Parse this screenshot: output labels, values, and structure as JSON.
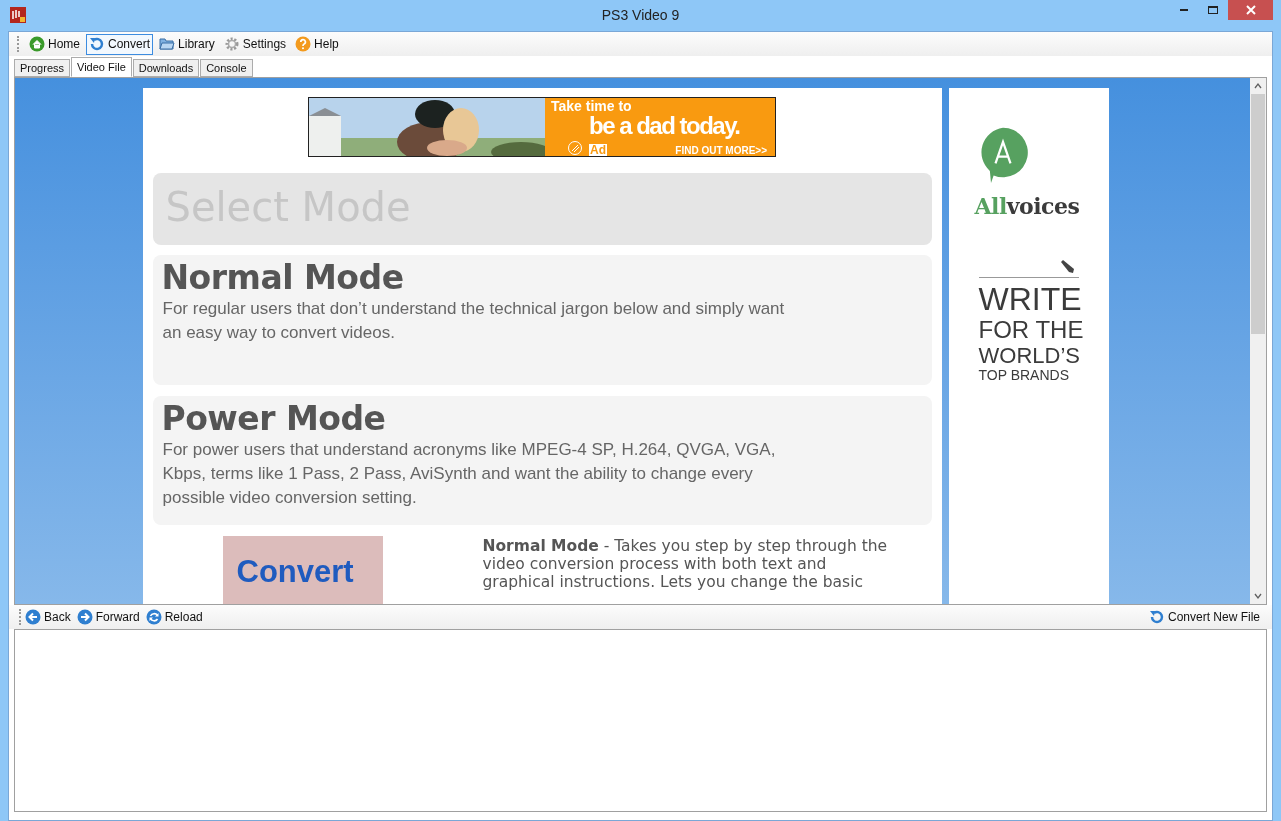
{
  "window": {
    "title": "PS3 Video 9"
  },
  "toolbar": [
    {
      "label": "Home",
      "selected": false
    },
    {
      "label": "Convert",
      "selected": true
    },
    {
      "label": "Library",
      "selected": false
    },
    {
      "label": "Settings",
      "selected": false
    },
    {
      "label": "Help",
      "selected": false
    }
  ],
  "tabs": [
    {
      "label": "Progress",
      "selected": false
    },
    {
      "label": "Video File",
      "selected": true
    },
    {
      "label": "Downloads",
      "selected": false
    },
    {
      "label": "Console",
      "selected": false
    }
  ],
  "banner": {
    "line_1": "Take time to",
    "line_2": "be a dad today.",
    "logo": "Ad",
    "link": "FIND OUT MORE>>"
  },
  "heading": "Select Mode",
  "modes": [
    {
      "title": "Normal Mode",
      "description": "For regular users that don’t understand the technical jargon below and simply want an easy way to convert videos."
    },
    {
      "title": "Power Mode",
      "description": "For power users that understand acronyms like MPEG-4 SP, H.264, QVGA, VGA, Kbps, terms like 1 Pass, 2 Pass, AviSynth and want the ability to change every possible video conversion setting."
    }
  ],
  "convert_tile": "Convert",
  "mode_detail": "**Normal Mode** - Takes you step by step through the video conversion process with both text and graphical instructions. Lets you change the basic",
  "side_ad": {
    "brand": [
      "All",
      "voices"
    ],
    "headline": [
      "WRITE",
      "FOR THE",
      "WORLD’S",
      "TOP BRANDS"
    ]
  },
  "nav": {
    "left": [
      {
        "label": "Back"
      },
      {
        "label": "Forward"
      },
      {
        "label": "Reload"
      }
    ],
    "right": {
      "label": "Convert New File"
    }
  }
}
